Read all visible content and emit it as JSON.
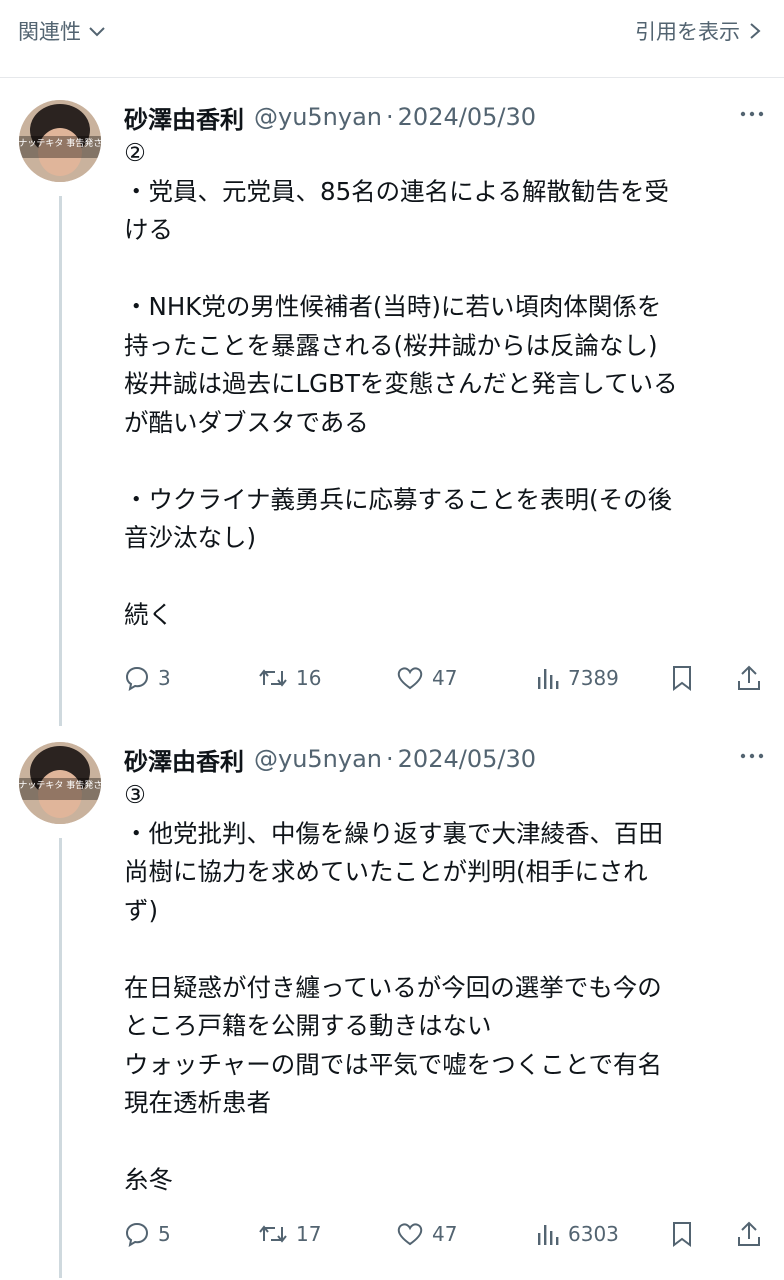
{
  "topbar": {
    "relevance_label": "関連性",
    "quotes_label": "引用を表示"
  },
  "icons": {
    "reply": "reply-icon",
    "retweet": "retweet-icon",
    "like": "heart-icon",
    "views": "views-icon",
    "bookmark": "bookmark-icon",
    "share": "share-icon",
    "more": "more-icon"
  },
  "colors": {
    "secondary_text": "#536471",
    "divider": "#e6e8eb",
    "thread_line": "#cfd9de"
  },
  "tweets": [
    {
      "name": "砂澤由香利",
      "handle": "@yu5nyan",
      "separator": "·",
      "date": "2024/05/30",
      "avatar_caption": "オタクナッテキタ 事告発されてき",
      "text": "②\n・党員、元党員、85名の連名による解散勧告を受\nける\n\n・NHK党の男性候補者(当時)に若い頃肉体関係を\n持ったことを暴露される(桜井誠からは反論なし)\n桜井誠は過去にLGBTを変態さんだと発言している\nが酷いダブスタである\n\n・ウクライナ義勇兵に応募することを表明(その後\n音沙汰なし)\n\n続く",
      "replies": "3",
      "retweets": "16",
      "likes": "47",
      "views": "7389"
    },
    {
      "name": "砂澤由香利",
      "handle": "@yu5nyan",
      "separator": "·",
      "date": "2024/05/30",
      "avatar_caption": "オタクナッテキタ 事告発されてき",
      "text": "③\n・他党批判、中傷を繰り返す裏で大津綾香、百田\n尚樹に協力を求めていたことが判明(相手にされ\nず)\n\n在日疑惑が付き纏っているが今回の選挙でも今の\nところ戸籍を公開する動きはない\nウォッチャーの間では平気で嘘をつくことで有名\n現在透析患者\n\n糸冬",
      "replies": "5",
      "retweets": "17",
      "likes": "47",
      "views": "6303"
    }
  ]
}
